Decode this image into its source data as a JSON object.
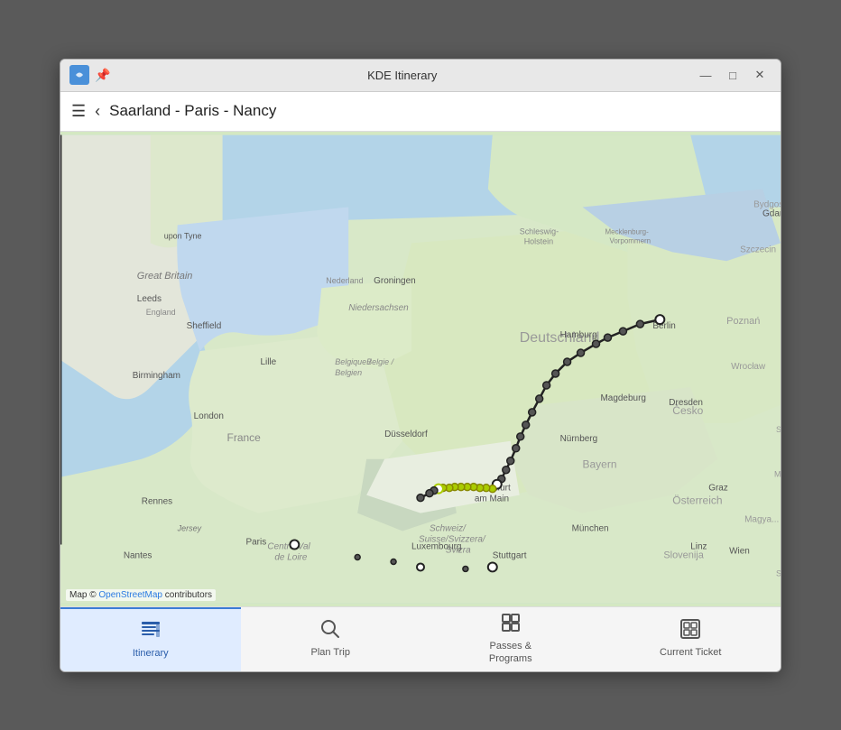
{
  "window": {
    "title": "KDE Itinerary",
    "icon": "🗺"
  },
  "header": {
    "title": "Saarland - Paris - Nancy"
  },
  "map": {
    "attribution_text": "Map © ",
    "attribution_link": "OpenStreetMap",
    "attribution_suffix": " contributors"
  },
  "tabs": [
    {
      "id": "itinerary",
      "label": "Itinerary",
      "icon": "≡",
      "icon_name": "itinerary-icon",
      "active": true
    },
    {
      "id": "plan-trip",
      "label": "Plan Trip",
      "icon": "🔍",
      "icon_name": "search-icon",
      "active": false
    },
    {
      "id": "passes-programs",
      "label": "Passes &\nPrograms",
      "icon": "▦",
      "icon_name": "passes-icon",
      "active": false
    },
    {
      "id": "current-ticket",
      "label": "Current Ticket",
      "icon": "⊞",
      "icon_name": "ticket-icon",
      "active": false
    }
  ],
  "title_bar": {
    "minimize_label": "—",
    "maximize_label": "□",
    "close_label": "✕",
    "pin_label": "📌"
  }
}
